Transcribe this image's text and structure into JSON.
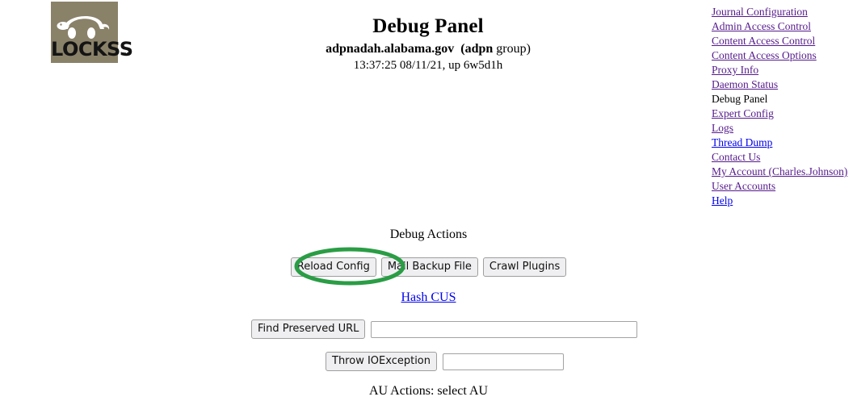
{
  "logo": {
    "wordmark": "LOCKSS",
    "trademark": "™",
    "square_color": "#8a8169",
    "turtle_color": "#ffffff"
  },
  "header": {
    "title": "Debug Panel",
    "host": "adpnadah.alabama.gov",
    "group_prefix": "(",
    "group_name": "adpn",
    "group_suffix": " group)",
    "uptime_line": "13:37:25 08/11/21, up 6w5d1h"
  },
  "nav": {
    "items": [
      {
        "label": "Journal Configuration",
        "state": "visited"
      },
      {
        "label": "Admin Access Control",
        "state": "visited"
      },
      {
        "label": "Content Access Control",
        "state": "visited"
      },
      {
        "label": "Content Access Options",
        "state": "visited"
      },
      {
        "label": "Proxy Info",
        "state": "visited"
      },
      {
        "label": "Daemon Status",
        "state": "visited"
      },
      {
        "label": "Debug Panel",
        "state": "current"
      },
      {
        "label": "Expert Config",
        "state": "visited"
      },
      {
        "label": "Logs",
        "state": "visited"
      },
      {
        "label": "Thread Dump",
        "state": "unvisited"
      },
      {
        "label": "Contact Us",
        "state": "visited"
      },
      {
        "label": "My Account (Charles.Johnson)",
        "state": "visited"
      },
      {
        "label": "User Accounts",
        "state": "visited"
      },
      {
        "label": "Help",
        "state": "unvisited"
      }
    ],
    "colors": {
      "visited": "#551a8b",
      "unvisited": "#0000ee",
      "current": "#000000"
    }
  },
  "main": {
    "debug_actions_heading": "Debug Actions",
    "au_actions_heading": "AU Actions: select AU",
    "buttons": {
      "reload_config": "Reload Config",
      "mail_backup_file": "Mail Backup File",
      "crawl_plugins": "Crawl Plugins",
      "find_preserved_url": "Find Preserved URL",
      "throw_ioexception": "Throw IOException"
    },
    "links": {
      "hash_cus": "Hash CUS"
    },
    "inputs": {
      "find_preserved_url_value": "",
      "find_preserved_url_placeholder": "",
      "throw_ioexception_value": "",
      "throw_ioexception_placeholder": ""
    }
  },
  "annotation": {
    "type": "ellipse-highlight",
    "target": "Reload Config",
    "color": "#2a9d45",
    "stroke_width": 5
  }
}
